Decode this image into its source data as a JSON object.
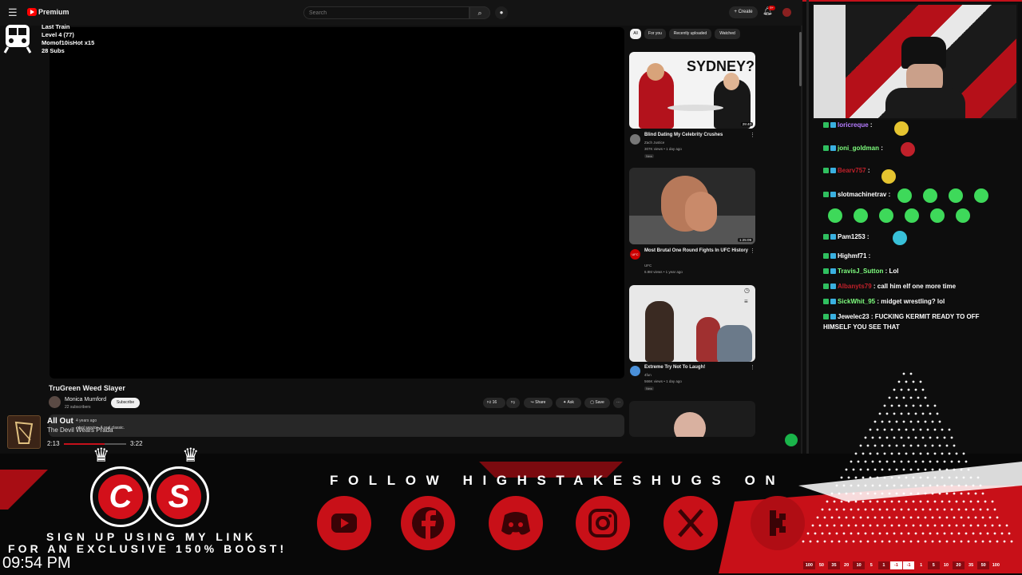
{
  "youtube": {
    "brand": "Premium",
    "search_placeholder": "Search",
    "create_label": "Create",
    "notif_count": "9+",
    "video": {
      "title": "TruGreen Weed Slayer",
      "channel": "Monica Mumford",
      "subscribers": "22 subscribers",
      "subscribe_label": "Subscribe",
      "likes": "16",
      "share_label": "Share",
      "ask_label": "Ask",
      "save_label": "Save",
      "description_date": "4 years ago",
      "description_snippet": "ntrol service.  A real classic."
    },
    "chips": [
      "All",
      "For you",
      "Recently uploaded",
      "Watched"
    ],
    "recommendations": [
      {
        "title": "Blind Dating My Celebrity Crushes",
        "channel": "Zach Justice",
        "meta": "307K views • 1 day ago",
        "badge": "New",
        "duration": "29:40",
        "thumb_text": "SYDNEY?"
      },
      {
        "title": "Most Brutal One Round Fights In UFC History",
        "channel": "UFC",
        "meta": "6.9M views • 1 year ago",
        "duration": "1:25:09",
        "avatar_text": "UFC"
      },
      {
        "title": "Extreme Try Not To Laugh!",
        "channel": "4fun",
        "meta": "566K views • 1 day ago",
        "badge": "New"
      }
    ]
  },
  "subs_overlay": {
    "lines": [
      "Last Train",
      "Level 4  (77)",
      "Momof10isHot x15",
      "28 Subs"
    ]
  },
  "now_playing": {
    "title": "All Out",
    "artist": "The Devil Wears Prada",
    "elapsed": "2:13",
    "total": "3:22",
    "progress": 0.66
  },
  "chat": [
    {
      "user": "loricreque",
      "color": "#b57cff",
      "msg": ""
    },
    {
      "user": "joni_goldman",
      "color": "#7fff7f",
      "msg": ""
    },
    {
      "user": "Bearv757",
      "color": "#c0202a",
      "msg": ""
    },
    {
      "user": "slotmachinetrav",
      "color": "#ffffff",
      "msg": ""
    },
    {
      "user": "Pam1253",
      "color": "#ffffff",
      "msg": ""
    },
    {
      "user": "Highmf71",
      "color": "#ffffff",
      "msg": ""
    },
    {
      "user": "TravisJ_Sutton",
      "color": "#7fff7f",
      "msg": "Lol"
    },
    {
      "user": "Albanyts79",
      "color": "#c0202a",
      "msg": "call him elf one more time"
    },
    {
      "user": "SickWhit_95",
      "color": "#7fff7f",
      "msg": "midget wrestling? lol"
    },
    {
      "user": "Jewelec23",
      "color": "#ffffff",
      "msg": "FUCKING KERMIT READY TO OFF"
    },
    {
      "user": "",
      "color": "#ffffff",
      "msg": "HIMSELF YOU SEE THAT"
    }
  ],
  "overlay": {
    "follow_text": "FOLLOW HIGHSTAKESHUGS ON",
    "signup_line1": "SIGN UP USING MY LINK",
    "signup_line2": "FOR AN EXCLUSIVE 150% BOOST!",
    "clock": "09:54 PM",
    "logo_letters": [
      "C",
      "S"
    ],
    "socials": [
      "youtube-icon",
      "facebook-icon",
      "discord-icon",
      "instagram-icon",
      "x-icon",
      "kick-icon"
    ],
    "ladder": [
      "100",
      "50",
      "35",
      "20",
      "10",
      "5",
      "1",
      "-1",
      "-1",
      "1",
      "5",
      "10",
      "20",
      "35",
      "50",
      "100"
    ]
  },
  "colors": {
    "accent_red": "#c81018",
    "yt_bg": "#0f0f0f"
  }
}
